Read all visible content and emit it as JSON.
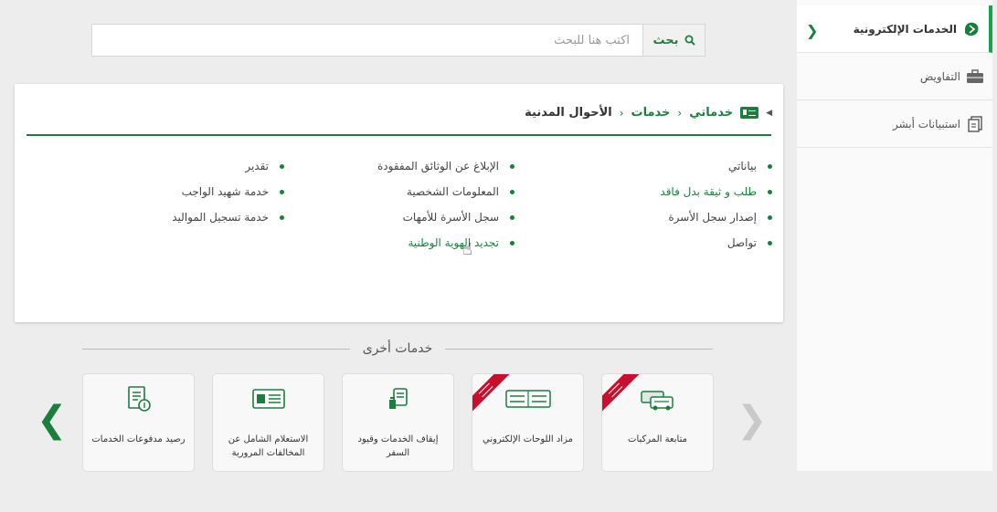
{
  "search": {
    "button_label": "بحث",
    "placeholder": "اكتب هنا للبحث"
  },
  "breadcrumb": {
    "items": [
      "خدماتي",
      "خدمات"
    ],
    "current": "الأحوال المدنية"
  },
  "services": {
    "col1": [
      "بياناتي",
      "طلب و ثيقة بدل فاقد",
      "إصدار سجل الأسرة",
      "تواصل"
    ],
    "col2": [
      "الإبلاغ عن الوثائق المفقودة",
      "المعلومات الشخصية",
      "سجل الأسرة للأمهات",
      "تجديد الهوية الوطنية"
    ],
    "col3": [
      "تقدير",
      "خدمة شهيد الواجب",
      "خدمة تسجيل المواليد"
    ]
  },
  "other_services": {
    "title": "خدمات أخرى",
    "tiles": [
      {
        "label": "متابعة المركبات",
        "icon": "vehicles-icon"
      },
      {
        "label": "مزاد اللوحات الإلكتروني",
        "icon": "plates-icon"
      },
      {
        "label": "إيقاف الخدمات وقيود السفر",
        "icon": "service-stop-icon"
      },
      {
        "label": "الاستعلام الشامل عن المخالفات المرورية",
        "icon": "id-card-icon"
      },
      {
        "label": "رصيد مدفوعات الخدمات",
        "icon": "payment-doc-icon"
      }
    ]
  },
  "sidebar": {
    "items": [
      {
        "label": "الخدمات الإلكترونية",
        "icon": "e-services-icon",
        "active": true
      },
      {
        "label": "التفاويض",
        "icon": "briefcase-icon",
        "active": false
      },
      {
        "label": "استبيانات أبشر",
        "icon": "survey-icon",
        "active": false
      }
    ]
  },
  "colors": {
    "accent": "#1a7f3c",
    "ribbon": "#c8102e"
  }
}
